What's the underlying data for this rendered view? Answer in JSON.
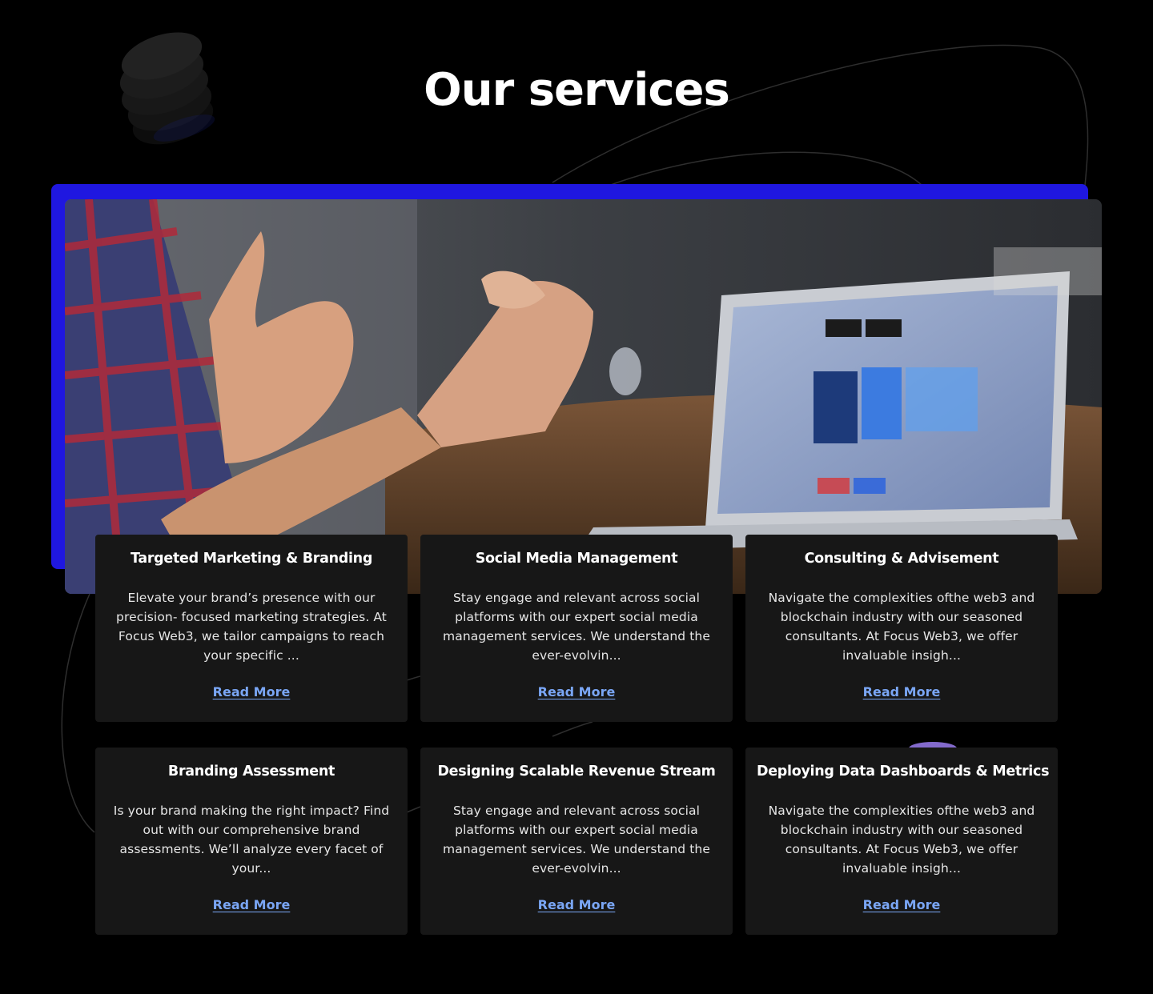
{
  "page": {
    "title": "Our services"
  },
  "colors": {
    "background": "#000000",
    "accent_frame": "#1f17e0",
    "card": "#171717",
    "link": "#7aa6f5"
  },
  "decor": {
    "top_left_icon": "coin-stack-icon",
    "hero": "meeting-laptop-photo"
  },
  "services": [
    {
      "title": "Targeted Marketing &  Branding",
      "description": "Elevate your brand’s presence with our precision- focused marketing strategies. At Focus Web3, we tailor campaigns to reach your specific ...",
      "link": "Read More"
    },
    {
      "title": "Social Media Management",
      "description": "Stay engage and relevant across social platforms with our expert social media management services. We understand the ever-evolvin...",
      "link": "Read More"
    },
    {
      "title": "Consulting & Advisement",
      "description": "Navigate the complexities ofthe web3 and blockchain industry with our seasoned consultants. At Focus Web3, we offer invaluable insigh...",
      "link": "Read More"
    },
    {
      "title": "Branding Assessment",
      "description": "Is your brand making the right impact? Find out with our comprehensive brand assessments. We’ll analyze every facet of your...",
      "link": "Read More"
    },
    {
      "title": "Designing Scalable Revenue Stream",
      "description": "Stay engage and relevant across social platforms with our expert social media management services. We understand the ever-evolvin...",
      "link": "Read More"
    },
    {
      "title": "Deploying Data Dashboards & Metrics",
      "description": "Navigate the complexities ofthe web3 and blockchain industry with our seasoned consultants. At Focus Web3, we offer invaluable insigh...",
      "link": "Read More"
    }
  ]
}
